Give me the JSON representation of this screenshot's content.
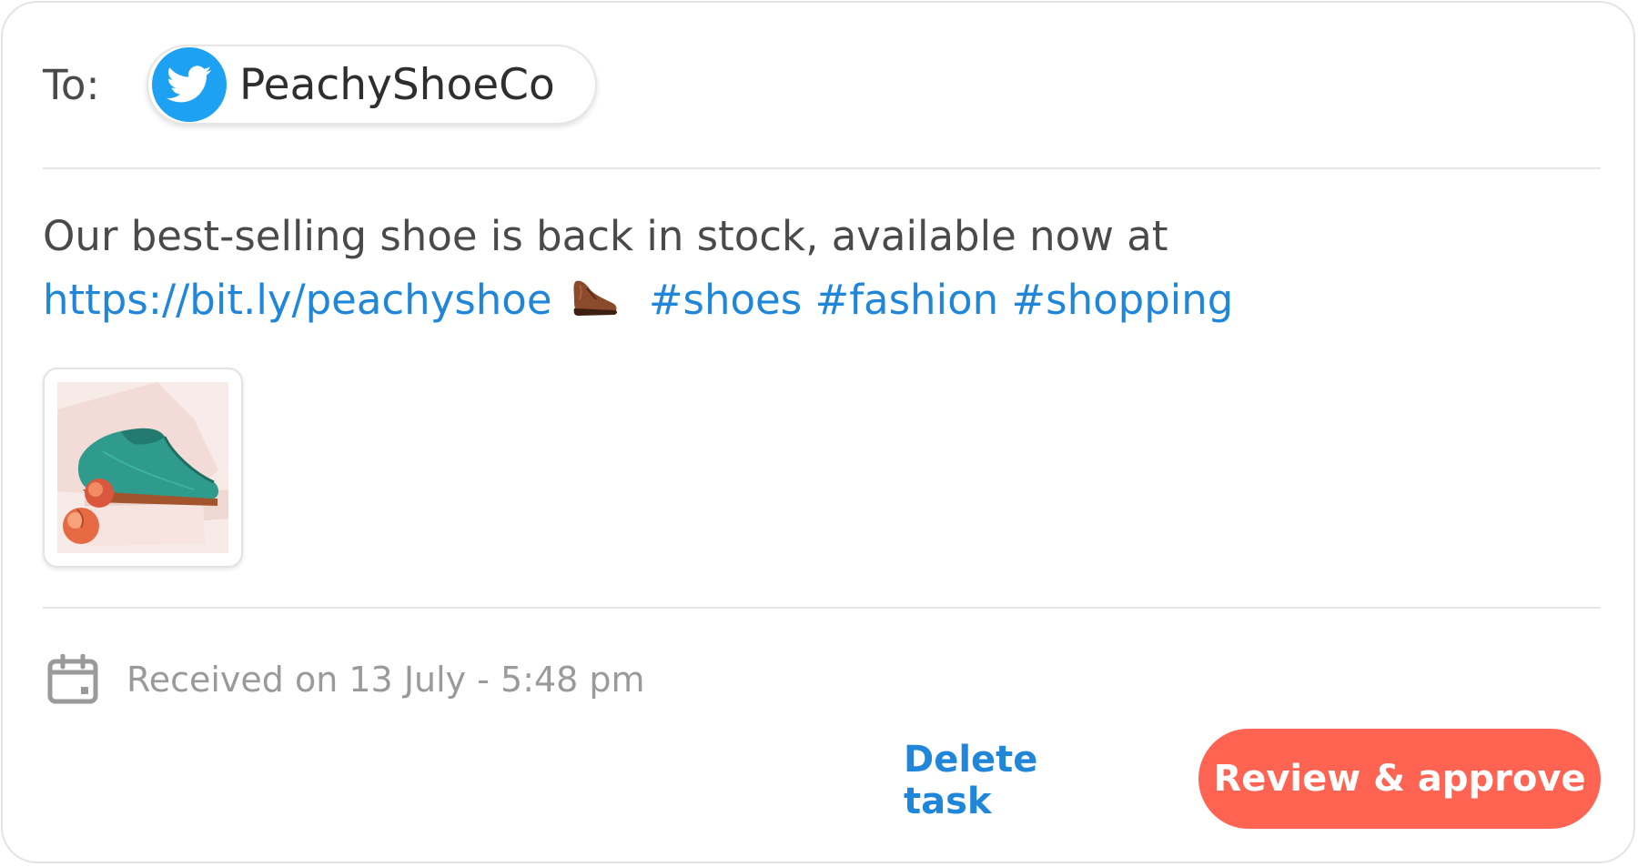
{
  "header": {
    "to_label": "To:",
    "account_name": "PeachyShoeCo",
    "account_icon": "twitter-icon"
  },
  "post": {
    "text": "Our best-selling shoe is back in stock, available now at",
    "link": "https://bit.ly/peachyshoe",
    "emoji_icon": "shoe-emoji-icon",
    "hashtags": [
      "#shoes",
      "#fashion",
      "#shopping"
    ],
    "attachment_icon": "shoe-product-thumbnail"
  },
  "meta": {
    "received": "Received on 13 July - 5:48 pm",
    "calendar_icon": "calendar-icon"
  },
  "actions": {
    "delete_label": "Delete task",
    "approve_label": "Review & approve"
  },
  "colors": {
    "link": "#1f86d9",
    "twitter": "#1da1f2",
    "approve_bg": "#ff6352",
    "text": "#4a4a4a",
    "muted": "#9a9a9a"
  }
}
